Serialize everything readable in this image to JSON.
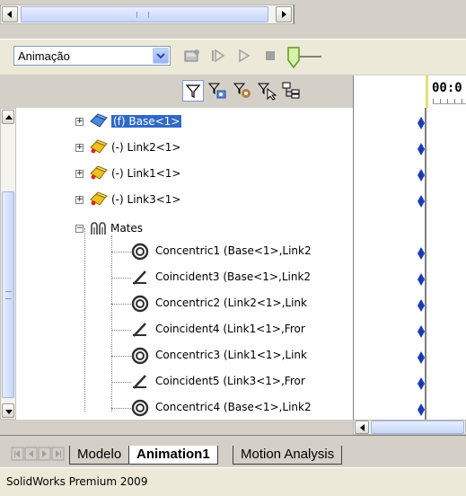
{
  "toolbar": {
    "mode_select": {
      "value": "Animação"
    }
  },
  "timeline": {
    "time_label": "00:0"
  },
  "tree": {
    "rows": [
      {
        "label": "(f) Base<1>",
        "selected": true
      },
      {
        "label": "(-) Link2<1>"
      },
      {
        "label": "(-) Link1<1>"
      },
      {
        "label": "(-) Link3<1>"
      },
      {
        "label": "Mates"
      },
      {
        "label": "Concentric1 (Base<1>,Link2"
      },
      {
        "label": "Coincident3 (Base<1>,Link2"
      },
      {
        "label": "Concentric2 (Link2<1>,Link"
      },
      {
        "label": "Coincident4 (Link1<1>,Fror"
      },
      {
        "label": "Concentric3 (Link1<1>,Link"
      },
      {
        "label": "Coincident5 (Link3<1>,Fror"
      },
      {
        "label": "Concentric4 (Base<1>,Link2"
      }
    ]
  },
  "tabs": [
    {
      "label": "Modelo"
    },
    {
      "label": "Animation1"
    },
    {
      "label": "Motion Analysis"
    }
  ],
  "status": {
    "text": "SolidWorks Premium 2009"
  },
  "colors": {
    "selection": "#316ac5",
    "keyframe": "#1a3bb5",
    "scroll_thumb": "#c7d6f6"
  }
}
